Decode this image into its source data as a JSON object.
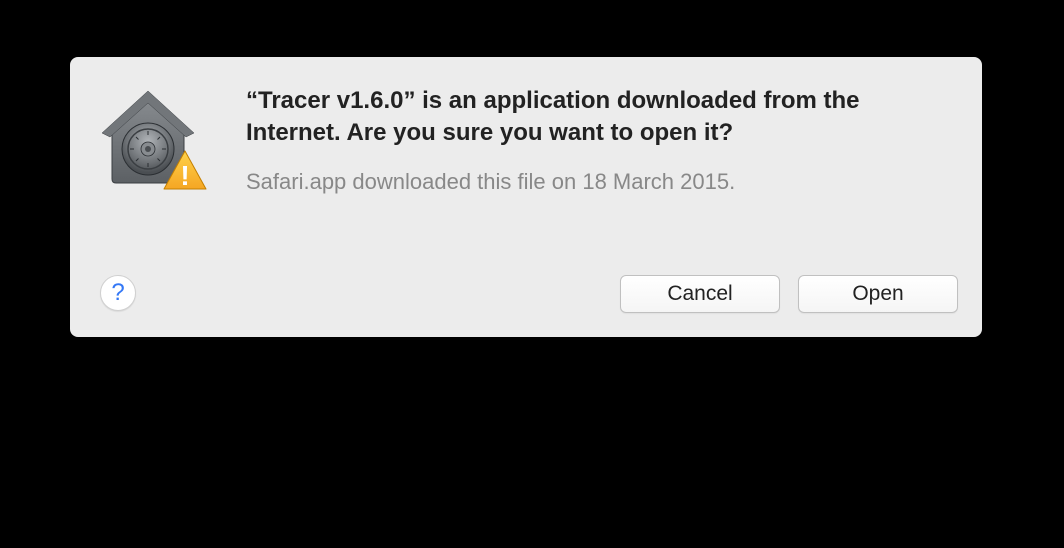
{
  "dialog": {
    "title": "“Tracer v1.6.0” is an application downloaded from the Internet. Are you sure you want to open it?",
    "subtitle": "Safari.app downloaded this file on 18 March 2015.",
    "buttons": {
      "cancel": "Cancel",
      "open": "Open"
    },
    "help": "?"
  }
}
